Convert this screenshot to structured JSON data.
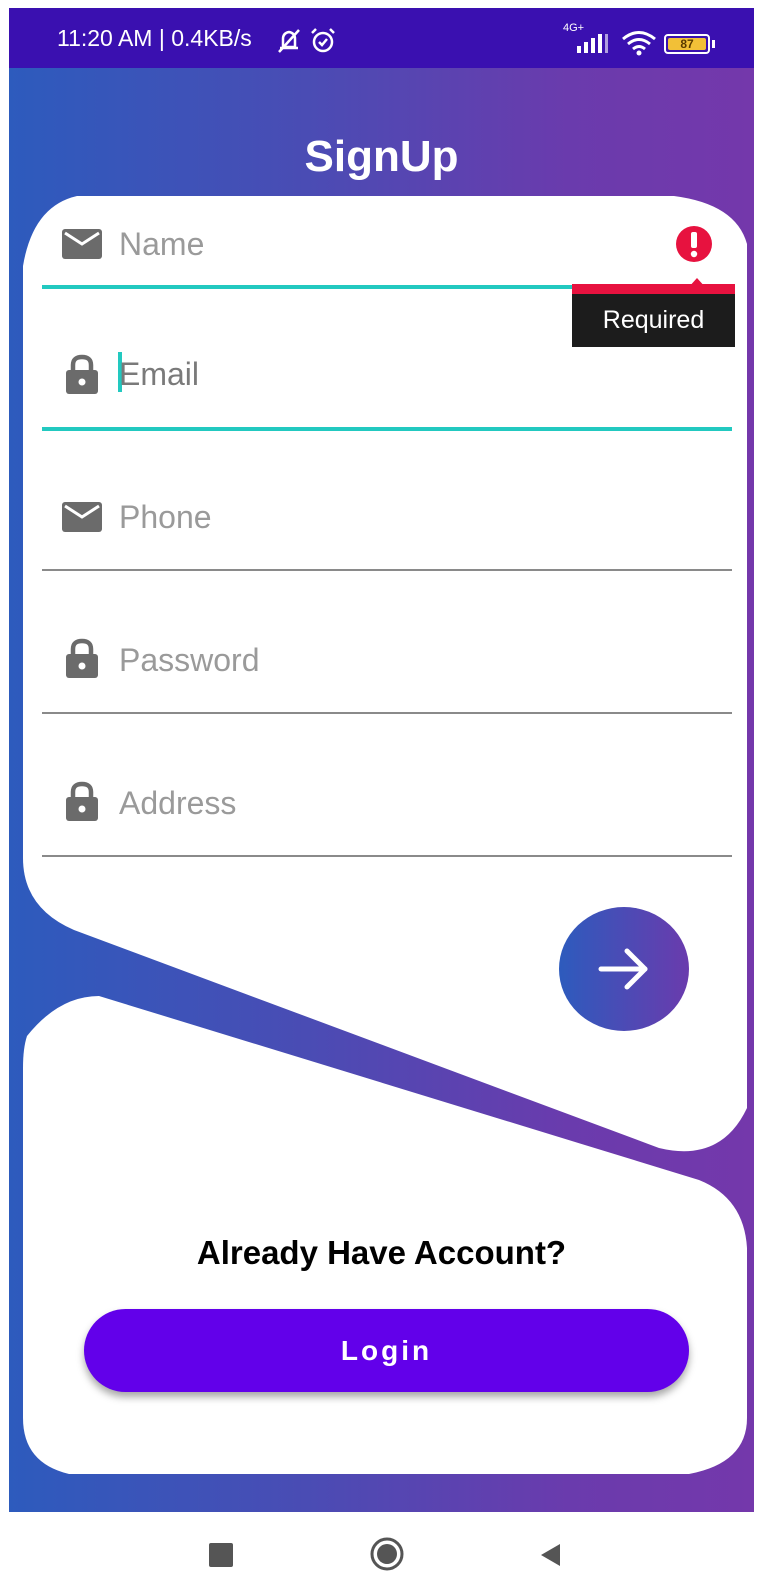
{
  "status_bar": {
    "time_text": "11:20 AM | 0.4KB/s",
    "network_label": "4G+",
    "battery_level": "87",
    "icons": [
      "muted-bell-icon",
      "alarm-icon",
      "signal-icon",
      "wifi-icon",
      "battery-icon"
    ]
  },
  "header": {
    "title": "SignUp"
  },
  "form": {
    "name": {
      "placeholder": "Name",
      "icon": "mail-icon",
      "error": "Required"
    },
    "email": {
      "placeholder": "Email",
      "icon": "lock-icon"
    },
    "phone": {
      "placeholder": "Phone",
      "icon": "mail-icon"
    },
    "password": {
      "placeholder": "Password",
      "icon": "lock-icon"
    },
    "address": {
      "placeholder": "Address",
      "icon": "lock-icon"
    },
    "submit_icon": "arrow-right-icon"
  },
  "login_section": {
    "prompt": "Already Have Account?",
    "login_label": "Login"
  },
  "nav_bar": {
    "icons": [
      "recents-icon",
      "home-icon",
      "back-icon"
    ]
  },
  "colors": {
    "gradient_start": "#2d5bbd",
    "gradient_end": "#7438ab",
    "accent": "#22c9c0",
    "error": "#e7123f",
    "login_button": "#6200ea"
  }
}
